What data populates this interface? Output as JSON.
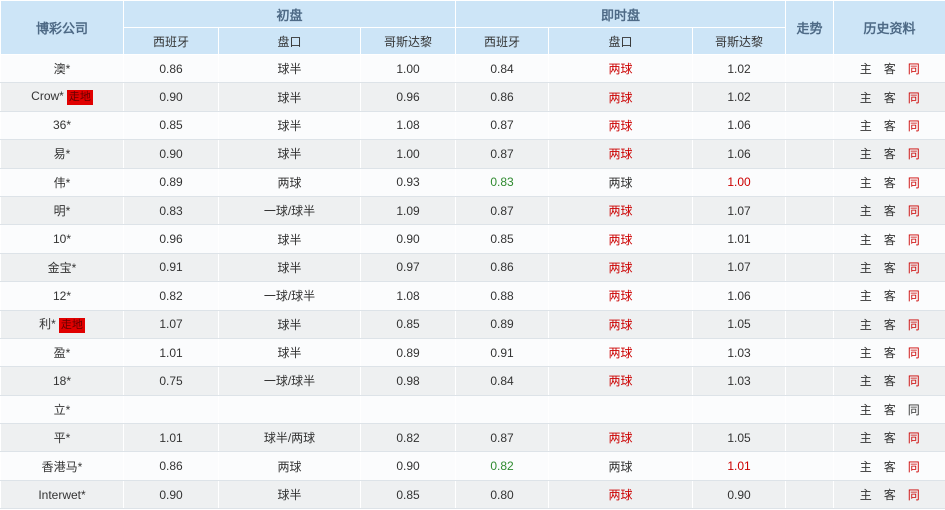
{
  "header": {
    "company": "博彩公司",
    "initial": "初盘",
    "live": "即时盘",
    "trend": "走势",
    "history": "历史资料",
    "sub": [
      "西班牙",
      "盘口",
      "哥斯达黎"
    ]
  },
  "history_links": {
    "home": "主",
    "away": "客",
    "same": "同"
  },
  "colors": {
    "red": "#cc0000",
    "green": "#2f8a2f",
    "header_bg": "#cde5f7"
  },
  "rows": [
    {
      "company": "澳*",
      "badge": "",
      "init": [
        "0.86",
        "球半",
        "1.00"
      ],
      "live": [
        "0.84",
        "两球",
        "1.02"
      ],
      "live_colors": [
        "",
        "red",
        ""
      ],
      "same_red": true
    },
    {
      "company": "Crow*",
      "badge": "走地",
      "init": [
        "0.90",
        "球半",
        "0.96"
      ],
      "live": [
        "0.86",
        "两球",
        "1.02"
      ],
      "live_colors": [
        "",
        "red",
        ""
      ],
      "same_red": true
    },
    {
      "company": "36*",
      "badge": "",
      "init": [
        "0.85",
        "球半",
        "1.08"
      ],
      "live": [
        "0.87",
        "两球",
        "1.06"
      ],
      "live_colors": [
        "",
        "red",
        ""
      ],
      "same_red": true
    },
    {
      "company": "易*",
      "badge": "",
      "init": [
        "0.90",
        "球半",
        "1.00"
      ],
      "live": [
        "0.87",
        "两球",
        "1.06"
      ],
      "live_colors": [
        "",
        "red",
        ""
      ],
      "same_red": true
    },
    {
      "company": "伟*",
      "badge": "",
      "init": [
        "0.89",
        "两球",
        "0.93"
      ],
      "live": [
        "0.83",
        "两球",
        "1.00"
      ],
      "live_colors": [
        "green",
        "",
        "red"
      ],
      "same_red": true
    },
    {
      "company": "明*",
      "badge": "",
      "init": [
        "0.83",
        "一球/球半",
        "1.09"
      ],
      "live": [
        "0.87",
        "两球",
        "1.07"
      ],
      "live_colors": [
        "",
        "red",
        ""
      ],
      "same_red": true
    },
    {
      "company": "10*",
      "badge": "",
      "init": [
        "0.96",
        "球半",
        "0.90"
      ],
      "live": [
        "0.85",
        "两球",
        "1.01"
      ],
      "live_colors": [
        "",
        "red",
        ""
      ],
      "same_red": true
    },
    {
      "company": "金宝*",
      "badge": "",
      "init": [
        "0.91",
        "球半",
        "0.97"
      ],
      "live": [
        "0.86",
        "两球",
        "1.07"
      ],
      "live_colors": [
        "",
        "red",
        ""
      ],
      "same_red": true
    },
    {
      "company": "12*",
      "badge": "",
      "init": [
        "0.82",
        "一球/球半",
        "1.08"
      ],
      "live": [
        "0.88",
        "两球",
        "1.06"
      ],
      "live_colors": [
        "",
        "red",
        ""
      ],
      "same_red": true
    },
    {
      "company": "利*",
      "badge": "走地",
      "init": [
        "1.07",
        "球半",
        "0.85"
      ],
      "live": [
        "0.89",
        "两球",
        "1.05"
      ],
      "live_colors": [
        "",
        "red",
        ""
      ],
      "same_red": true
    },
    {
      "company": "盈*",
      "badge": "",
      "init": [
        "1.01",
        "球半",
        "0.89"
      ],
      "live": [
        "0.91",
        "两球",
        "1.03"
      ],
      "live_colors": [
        "",
        "red",
        ""
      ],
      "same_red": true
    },
    {
      "company": "18*",
      "badge": "",
      "init": [
        "0.75",
        "一球/球半",
        "0.98"
      ],
      "live": [
        "0.84",
        "两球",
        "1.03"
      ],
      "live_colors": [
        "",
        "red",
        ""
      ],
      "same_red": true
    },
    {
      "company": "立*",
      "badge": "",
      "init": [
        "",
        "",
        ""
      ],
      "live": [
        "",
        "",
        ""
      ],
      "live_colors": [
        "",
        "",
        ""
      ],
      "same_red": false
    },
    {
      "company": "平*",
      "badge": "",
      "init": [
        "1.01",
        "球半/两球",
        "0.82"
      ],
      "live": [
        "0.87",
        "两球",
        "1.05"
      ],
      "live_colors": [
        "",
        "red",
        ""
      ],
      "same_red": true
    },
    {
      "company": "香港马*",
      "badge": "",
      "init": [
        "0.86",
        "两球",
        "0.90"
      ],
      "live": [
        "0.82",
        "两球",
        "1.01"
      ],
      "live_colors": [
        "green",
        "",
        "red"
      ],
      "same_red": true
    },
    {
      "company": "Interwet*",
      "badge": "",
      "init": [
        "0.90",
        "球半",
        "0.85"
      ],
      "live": [
        "0.80",
        "两球",
        "0.90"
      ],
      "live_colors": [
        "",
        "red",
        ""
      ],
      "same_red": true
    }
  ]
}
